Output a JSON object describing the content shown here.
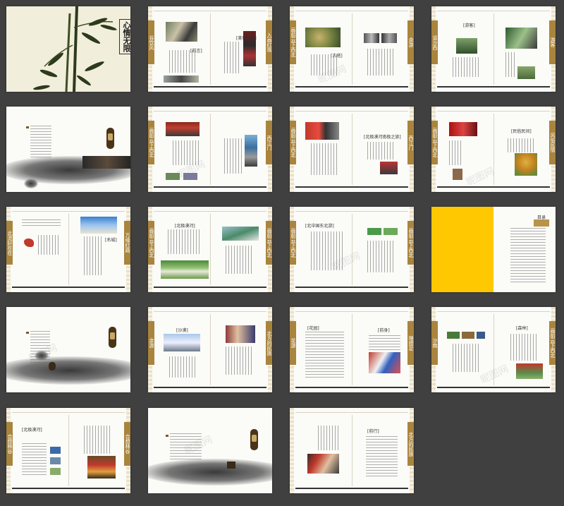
{
  "cover": {
    "title": "心情无限"
  },
  "tabs": {
    "t2_left": "谷饮风",
    "t2_right": "入画红珠",
    "t2b_left": "画前云下西北",
    "t3_right": "余游",
    "t4_left": "谈沙西",
    "t4_right": "游客",
    "t6_left": "画前云下西北",
    "t6_right": "西江门",
    "t7_left": "画前云下西北",
    "t7_right": "西江门",
    "t8_left": "画前云下西北",
    "t8_right": "风俗民情",
    "t9_left": "北流好在在",
    "t9_right": "万缘红路",
    "t10_left": "画前云下西北",
    "t10_right": "画前云下西北",
    "t11_left": "画前云下西北",
    "t11_right": "画前云下西北",
    "t14_left": "余游",
    "t14_right": "北方的民族",
    "t15_left": "花游",
    "t15_right": "理想足",
    "t16_left": "沙南",
    "t16_right": "画前云下西北",
    "t17_left": "合想林谷",
    "t17_right": "合想林谷",
    "t19_right": "北方的民族"
  },
  "headings": {
    "h2a": "[前言]",
    "h2b": "[美丽前言]",
    "h3a": "[古塔]",
    "h4a": "[游客]",
    "h7a": "[北极漠河南极之旅]",
    "h8a": "[民俗民间]",
    "h9a": "[名城]",
    "h10a": "[北极漠河]",
    "h11a": "[北中国东北游]",
    "h12a": "目录",
    "h14a": "[沙漠]",
    "h15a": "[花园]",
    "h15b": "[前身]",
    "h16a": "[森林]",
    "h17a": "[北极漠河]",
    "h19a": "[前行]"
  },
  "watermark": "昵图网",
  "colors": {
    "background": "#404040",
    "accent": "#b8944a",
    "yellow": "#ffc800"
  }
}
